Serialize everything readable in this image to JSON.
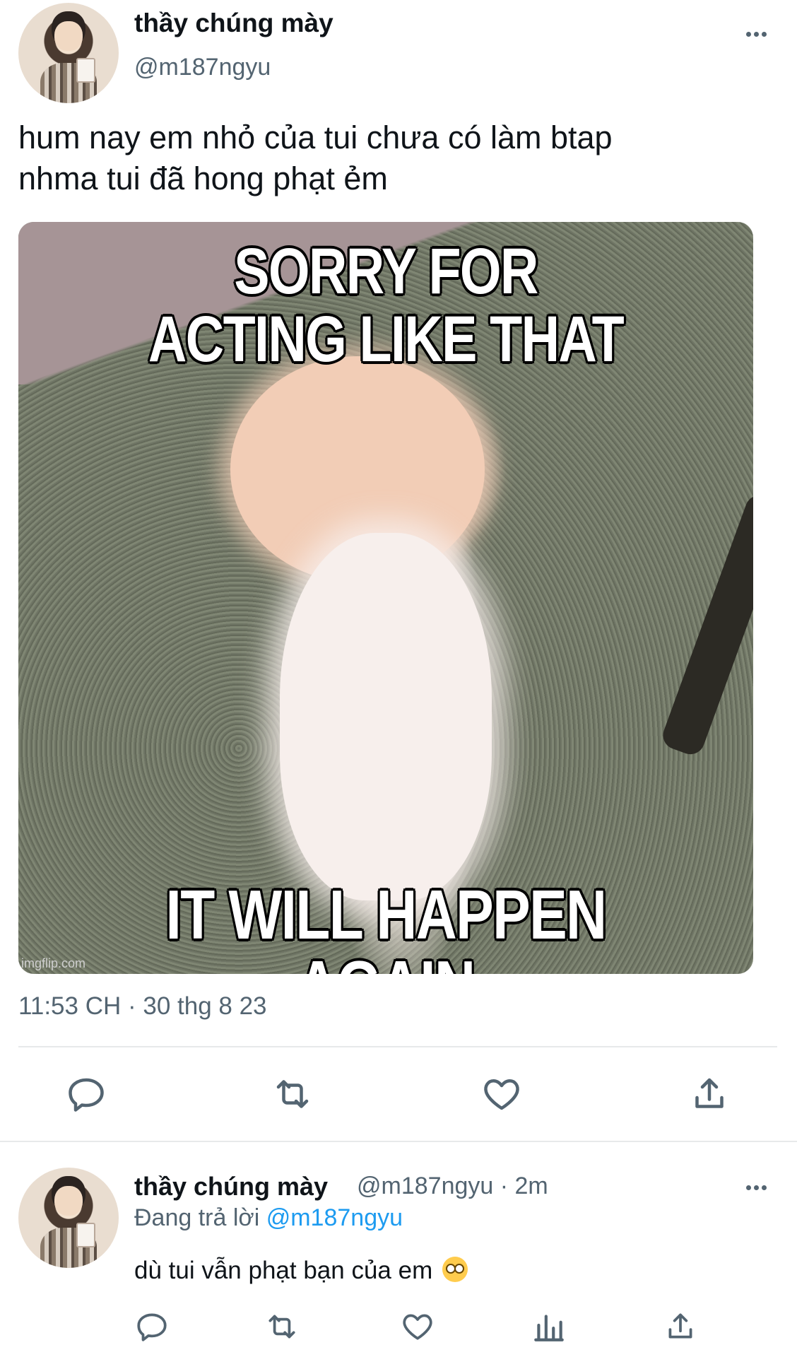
{
  "tweet": {
    "author_name": "thầy chúng mày",
    "author_handle": "@m187ngyu",
    "text_line1": "hum nay em nhỏ của tui chưa có làm btap",
    "text_line2": "nhma tui đã hong phạt ẻm",
    "media": {
      "top_line1": "SORRY FOR",
      "top_line2": "ACTING LIKE THAT",
      "bottom_line": "IT WILL HAPPEN AGAIN",
      "watermark": "imgflip.com"
    },
    "timestamp": "11:53 CH · 30 thg 8 23",
    "actions": [
      "reply-icon",
      "retweet-icon",
      "like-icon",
      "share-icon"
    ]
  },
  "reply": {
    "author_name": "thầy chúng mày",
    "author_handle_time": "@m187ngyu · 2m",
    "replying_prefix": "Đang trả lời",
    "replying_mention": "@m187ngyu",
    "text": "dù tui vẫn phạt bạn của em",
    "emoji": "flushed-face-emoji",
    "actions": [
      "reply-icon",
      "retweet-icon",
      "like-icon",
      "analytics-icon",
      "share-icon"
    ]
  },
  "colors": {
    "text": "#0f1419",
    "secondary": "#536471",
    "link": "#1d9bf0",
    "divider": "#e7e9ea"
  }
}
